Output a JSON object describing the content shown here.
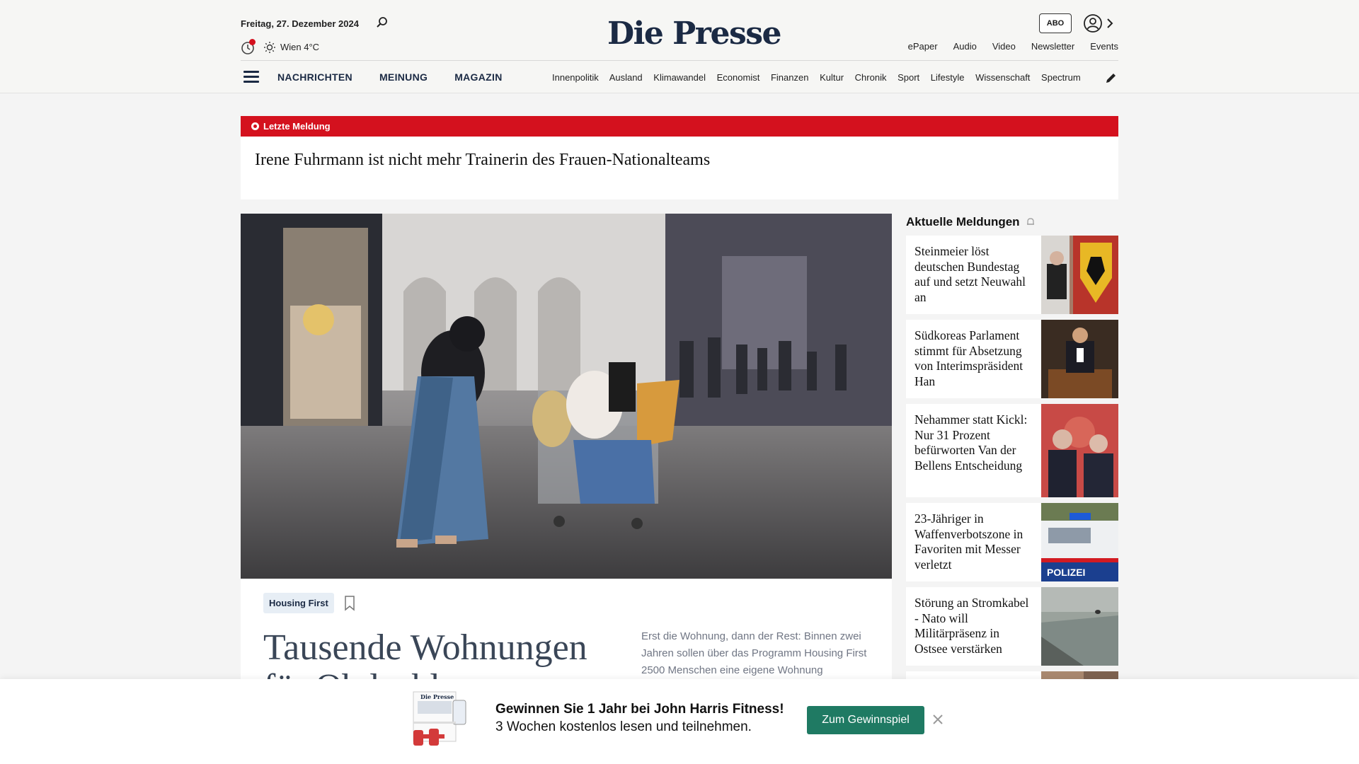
{
  "header": {
    "date": "Freitag, 27. Dezember 2024",
    "weather": "Wien 4°C",
    "logo": "Die Presse",
    "abo_label": "ABO",
    "top_links": [
      "ePaper",
      "Audio",
      "Video",
      "Newsletter",
      "Events"
    ],
    "main_nav": [
      "NACHRICHTEN",
      "MEINUNG",
      "MAGAZIN"
    ],
    "sub_nav": [
      "Innenpolitik",
      "Ausland",
      "Klimawandel",
      "Economist",
      "Finanzen",
      "Kultur",
      "Chronik",
      "Sport",
      "Lifestyle",
      "Wissenschaft",
      "Spectrum"
    ]
  },
  "breaking": {
    "label": "Letzte Meldung",
    "headline": "Irene Fuhrmann ist nicht mehr Trainerin des Frauen-Nationalteams"
  },
  "article": {
    "tag": "Housing First",
    "headline": "Tausende Wohnungen für Obdachlose",
    "teaser": "Erst die Wohnung, dann der Rest: Binnen zwei Jahren sollen über das Programm Housing First 2500 Menschen eine eigene Wohnung"
  },
  "sidebar": {
    "title": "Aktuelle Meldungen",
    "items": [
      {
        "text": "Steinmeier löst deutschen Bundestag auf und setzt Neuwahl an"
      },
      {
        "text": "Südkoreas Parlament stimmt für Absetzung von Interimspräsident Han"
      },
      {
        "text": "Nehammer statt Kickl: Nur 31 Prozent befürworten Van der Bellens Entscheidung"
      },
      {
        "text": "23-Jähriger in Waffenverbotszone in Favoriten mit Messer verletzt",
        "thumb_text": "POLIZEI"
      },
      {
        "text": "Störung an Stromkabel - Nato will Militärpräsenz in Ostsee verstärken"
      }
    ]
  },
  "promo": {
    "title": "Gewinnen Sie 1 Jahr bei John Harris Fitness!",
    "subtitle": "3 Wochen kostenlos lesen und teilnehmen.",
    "button": "Zum Gewinnspiel",
    "image_label": "Die Presse"
  },
  "colors": {
    "brand": "#1b2a44",
    "breaking_red": "#d4111e",
    "cta_green": "#1f7a63"
  }
}
